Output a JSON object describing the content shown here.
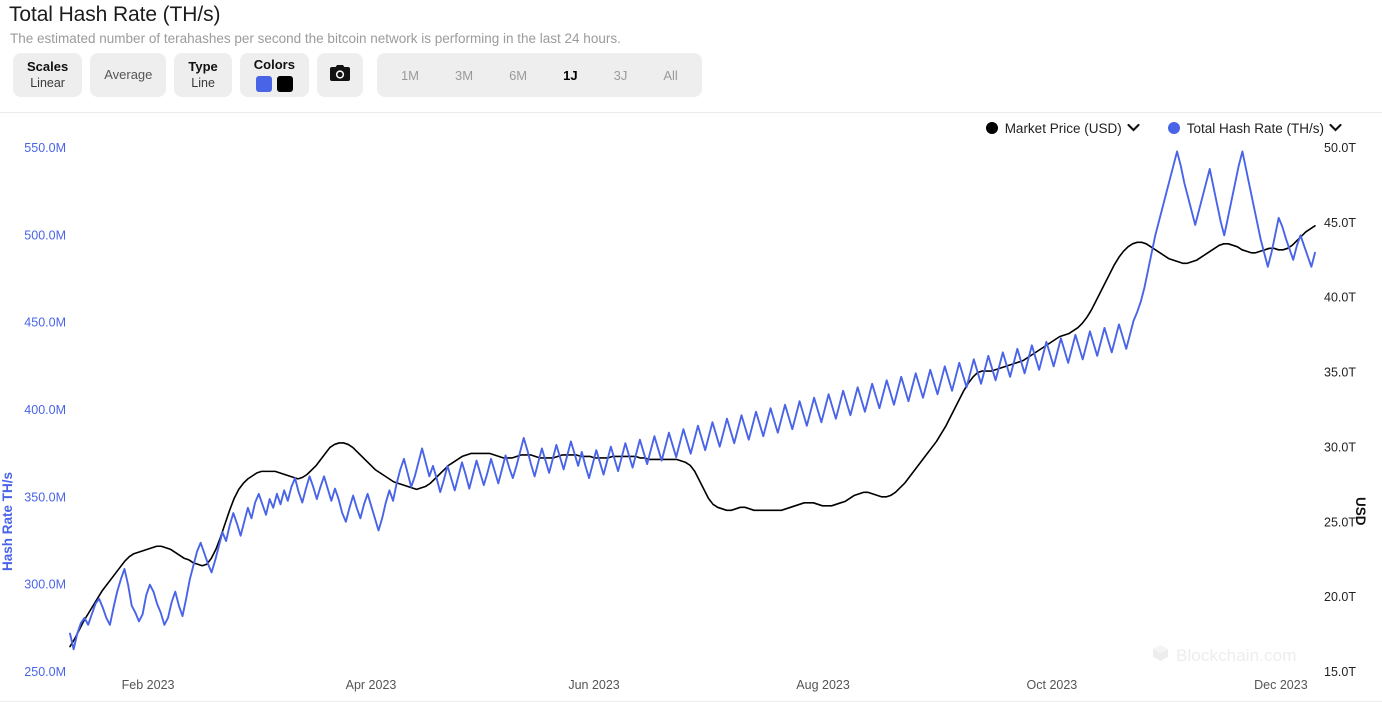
{
  "header": {
    "title": "Total Hash Rate (TH/s)",
    "subtitle": "The estimated number of terahashes per second the bitcoin network is performing in the last 24 hours."
  },
  "toolbar": {
    "scales": {
      "label": "Scales",
      "value": "Linear"
    },
    "average": {
      "label": "Average"
    },
    "type": {
      "label": "Type",
      "value": "Line"
    },
    "colors": {
      "label": "Colors",
      "swatch_1": "#4a64e8",
      "swatch_2": "#000000"
    },
    "camera": {
      "icon": "camera-icon"
    },
    "ranges": [
      {
        "label": "1M",
        "active": false
      },
      {
        "label": "3M",
        "active": false
      },
      {
        "label": "6M",
        "active": false
      },
      {
        "label": "1J",
        "active": true
      },
      {
        "label": "3J",
        "active": false
      },
      {
        "label": "All",
        "active": false
      }
    ]
  },
  "legend": [
    {
      "label": "Market Price (USD)",
      "color": "#000000",
      "icon": "chevron-down-icon"
    },
    {
      "label": "Total Hash Rate (TH/s)",
      "color": "#4a64e8",
      "icon": "chevron-down-icon"
    }
  ],
  "watermark": {
    "text": "Blockchain.com",
    "icon": "cube-logo-icon"
  },
  "chart_data": {
    "type": "line",
    "title": "Total Hash Rate (TH/s)",
    "subtitle": "The estimated number of terahashes per second the bitcoin network is performing in the last 24 hours.",
    "grid": false,
    "legend_position": "top-right",
    "xlabel": "",
    "x_tick_labels": [
      "Feb 2023",
      "Apr 2023",
      "Jun 2023",
      "Aug 2023",
      "Oct 2023",
      "Dec 2023"
    ],
    "x_tick_positions_frac": [
      0.0565,
      0.2178,
      0.3792,
      0.5449,
      0.7105,
      0.8762
    ],
    "axes": [
      {
        "side": "left",
        "label": "Hash Rate TH/s",
        "color": "#4a64e8",
        "ylim": [
          250000000,
          550000000
        ],
        "tick_labels": [
          "550.0M",
          "500.0M",
          "450.0M",
          "400.0M",
          "350.0M",
          "300.0M",
          "250.0M"
        ],
        "tick_values": [
          550000000,
          500000000,
          450000000,
          400000000,
          350000000,
          300000000,
          250000000
        ]
      },
      {
        "side": "right",
        "label": "USD",
        "color": "#111111",
        "ylim": [
          15000,
          50000
        ],
        "tick_labels": [
          "50.0T",
          "45.0T",
          "40.0T",
          "35.0T",
          "30.0T",
          "25.0T",
          "20.0T",
          "15.0T"
        ],
        "tick_values": [
          50000,
          45000,
          40000,
          35000,
          30000,
          25000,
          20000,
          15000
        ]
      }
    ],
    "series": [
      {
        "name": "Total Hash Rate (TH/s)",
        "color": "#4a64e8",
        "axis": "left",
        "unit": "M",
        "values": [
          272,
          263,
          272,
          278,
          281,
          277,
          283,
          289,
          292,
          287,
          281,
          277,
          287,
          296,
          303,
          309,
          300,
          288,
          284,
          279,
          283,
          294,
          300,
          296,
          289,
          284,
          277,
          281,
          290,
          296,
          288,
          282,
          292,
          303,
          311,
          319,
          324,
          318,
          312,
          307,
          314,
          322,
          330,
          325,
          334,
          341,
          335,
          328,
          336,
          344,
          338,
          347,
          352,
          346,
          340,
          349,
          344,
          352,
          346,
          354,
          348,
          356,
          361,
          353,
          347,
          355,
          362,
          356,
          349,
          356,
          362,
          355,
          348,
          355,
          349,
          341,
          336,
          344,
          351,
          344,
          338,
          346,
          352,
          345,
          338,
          331,
          338,
          347,
          354,
          348,
          358,
          366,
          372,
          364,
          356,
          362,
          370,
          378,
          370,
          362,
          368,
          361,
          353,
          360,
          368,
          361,
          354,
          362,
          370,
          363,
          355,
          363,
          371,
          364,
          357,
          364,
          372,
          365,
          358,
          366,
          374,
          367,
          361,
          368,
          376,
          384,
          377,
          369,
          362,
          370,
          378,
          371,
          364,
          372,
          380,
          373,
          366,
          374,
          382,
          375,
          368,
          376,
          368,
          361,
          369,
          377,
          370,
          363,
          371,
          379,
          372,
          365,
          373,
          381,
          374,
          367,
          375,
          383,
          376,
          369,
          377,
          385,
          378,
          371,
          379,
          387,
          380,
          373,
          381,
          389,
          382,
          375,
          383,
          391,
          384,
          377,
          385,
          393,
          386,
          379,
          387,
          395,
          388,
          381,
          389,
          397,
          390,
          383,
          391,
          399,
          392,
          385,
          393,
          401,
          394,
          387,
          395,
          403,
          396,
          389,
          397,
          405,
          398,
          391,
          399,
          407,
          400,
          393,
          401,
          409,
          402,
          395,
          403,
          411,
          404,
          397,
          405,
          413,
          406,
          399,
          407,
          415,
          408,
          401,
          409,
          417,
          410,
          403,
          411,
          419,
          412,
          405,
          413,
          421,
          414,
          407,
          415,
          423,
          416,
          409,
          417,
          425,
          418,
          411,
          419,
          427,
          420,
          413,
          421,
          429,
          422,
          415,
          423,
          431,
          424,
          417,
          425,
          433,
          426,
          419,
          427,
          435,
          428,
          421,
          429,
          437,
          430,
          423,
          431,
          439,
          432,
          425,
          433,
          441,
          434,
          427,
          435,
          443,
          436,
          429,
          437,
          445,
          438,
          431,
          439,
          447,
          440,
          433,
          441,
          449,
          442,
          435,
          443,
          451,
          456,
          462,
          470,
          480,
          490,
          500,
          508,
          516,
          524,
          532,
          540,
          548,
          540,
          530,
          522,
          514,
          506,
          514,
          522,
          530,
          538,
          528,
          518,
          508,
          500,
          510,
          520,
          530,
          540,
          548,
          538,
          528,
          518,
          508,
          498,
          490,
          482,
          490,
          500,
          510,
          505,
          498,
          492,
          486,
          494,
          500,
          494,
          488,
          482,
          490
        ]
      },
      {
        "name": "Market Price (USD)",
        "color": "#000000",
        "axis": "right",
        "unit": "T",
        "values": [
          16.7,
          17.2,
          17.8,
          18.4,
          18.9,
          19.4,
          19.9,
          20.4,
          20.8,
          21.2,
          21.6,
          22.0,
          22.4,
          22.7,
          22.9,
          23.0,
          23.1,
          23.2,
          23.3,
          23.4,
          23.4,
          23.3,
          23.2,
          23.0,
          22.8,
          22.6,
          22.5,
          22.3,
          22.2,
          22.1,
          22.2,
          22.6,
          23.2,
          24.0,
          24.9,
          25.8,
          26.6,
          27.2,
          27.6,
          27.9,
          28.1,
          28.3,
          28.4,
          28.4,
          28.4,
          28.4,
          28.3,
          28.2,
          28.1,
          28.0,
          27.9,
          28.0,
          28.2,
          28.5,
          28.8,
          29.2,
          29.6,
          30.0,
          30.2,
          30.3,
          30.3,
          30.2,
          30.0,
          29.7,
          29.4,
          29.1,
          28.8,
          28.5,
          28.3,
          28.1,
          27.9,
          27.7,
          27.6,
          27.5,
          27.4,
          27.3,
          27.2,
          27.3,
          27.4,
          27.6,
          27.9,
          28.2,
          28.5,
          28.8,
          29.0,
          29.2,
          29.4,
          29.5,
          29.6,
          29.6,
          29.6,
          29.6,
          29.6,
          29.5,
          29.4,
          29.3,
          29.3,
          29.3,
          29.4,
          29.5,
          29.5,
          29.5,
          29.4,
          29.3,
          29.3,
          29.3,
          29.3,
          29.4,
          29.5,
          29.5,
          29.5,
          29.5,
          29.4,
          29.4,
          29.4,
          29.3,
          29.3,
          29.3,
          29.3,
          29.4,
          29.4,
          29.4,
          29.4,
          29.4,
          29.4,
          29.3,
          29.3,
          29.2,
          29.2,
          29.2,
          29.2,
          29.2,
          29.2,
          29.2,
          29.1,
          29.0,
          28.8,
          28.4,
          27.8,
          27.2,
          26.6,
          26.2,
          26.0,
          25.9,
          25.8,
          25.8,
          25.9,
          26.0,
          26.0,
          25.9,
          25.8,
          25.8,
          25.8,
          25.8,
          25.8,
          25.8,
          25.8,
          25.9,
          26.0,
          26.1,
          26.2,
          26.3,
          26.3,
          26.3,
          26.2,
          26.1,
          26.1,
          26.1,
          26.2,
          26.3,
          26.4,
          26.6,
          26.8,
          26.9,
          27.0,
          27.0,
          26.9,
          26.8,
          26.7,
          26.7,
          26.8,
          27.0,
          27.3,
          27.6,
          28.0,
          28.4,
          28.8,
          29.2,
          29.6,
          30.0,
          30.4,
          30.9,
          31.4,
          32.0,
          32.6,
          33.2,
          33.8,
          34.3,
          34.7,
          35.0,
          35.1,
          35.1,
          35.1,
          35.2,
          35.3,
          35.4,
          35.5,
          35.6,
          35.7,
          35.8,
          36.0,
          36.2,
          36.4,
          36.6,
          36.8,
          37.0,
          37.2,
          37.4,
          37.5,
          37.6,
          37.8,
          38.0,
          38.3,
          38.7,
          39.2,
          39.8,
          40.4,
          41.0,
          41.6,
          42.2,
          42.7,
          43.1,
          43.4,
          43.6,
          43.7,
          43.7,
          43.6,
          43.4,
          43.2,
          43.0,
          42.8,
          42.6,
          42.5,
          42.4,
          42.3,
          42.3,
          42.4,
          42.5,
          42.7,
          42.9,
          43.1,
          43.3,
          43.5,
          43.6,
          43.6,
          43.5,
          43.4,
          43.2,
          43.1,
          43.0,
          43.0,
          43.1,
          43.2,
          43.3,
          43.3,
          43.2,
          43.2,
          43.3,
          43.5,
          43.8,
          44.1,
          44.4,
          44.6,
          44.8
        ]
      }
    ]
  }
}
